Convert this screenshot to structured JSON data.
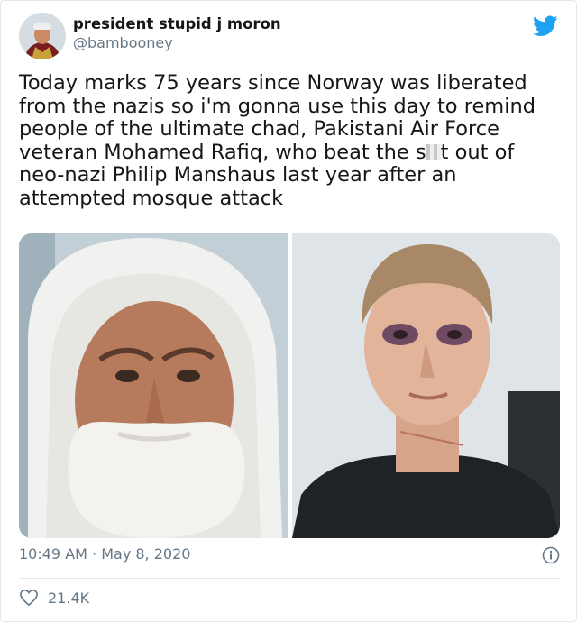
{
  "user": {
    "display_name": "president stupid j moron",
    "handle": "@bambooney"
  },
  "tweet": {
    "line1": "Today marks 75 years since Norway was liberated",
    "line2": "from the nazis so i'm gonna use this day to remind",
    "line3": "people of the ultimate chad, Pakistani Air Force",
    "line4_a": "veteran Mohamed Rafiq, who beat the s",
    "line4_b": "t out of",
    "line5": "neo-nazi Philip Manshaus last year after an",
    "line6": "attempted mosque attack"
  },
  "timestamp": "10:49 AM · May 8, 2020",
  "likes": "21.4K",
  "colors": {
    "twitter_blue": "#1da1f2",
    "secondary_text": "#657786",
    "primary_text": "#14171a",
    "divider": "#e1e8ed"
  },
  "icons": [
    "twitter-bird-icon",
    "info-icon",
    "heart-icon"
  ]
}
